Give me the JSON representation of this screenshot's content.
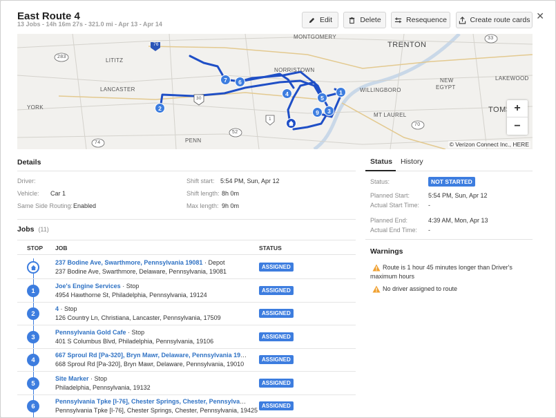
{
  "header": {
    "title": "East Route 4",
    "subtitle": "13 Jobs - 14h 16m 27s - 321.0 mi - Apr 13 - Apr 14",
    "buttons": {
      "edit": "Edit",
      "delete": "Delete",
      "resequence": "Resequence",
      "create_cards": "Create route cards"
    }
  },
  "map": {
    "labels": {
      "montgomery": "MONTGOMERY",
      "trenton": "TRENTON",
      "lititz": "LITITZ",
      "norristown": "NORRISTOWN",
      "lancaster": "LANCASTER",
      "willingboro": "WILLINGBORO",
      "lakewood": "LAKEWOOD",
      "new": "NEW",
      "egypt": "EGYPT",
      "york": "YORK",
      "toms": "TOMS",
      "mtlaurel": "MT LAUREL",
      "penn": "PENN"
    },
    "shields": {
      "s283": "283",
      "s76": "76",
      "s30": "30",
      "s1": "1",
      "s52": "52",
      "s74": "74",
      "s70": "70",
      "s33": "33"
    },
    "stops": [
      "7",
      "6",
      "5",
      "4",
      "1",
      "2",
      "9",
      "3"
    ],
    "zoom_in": "+",
    "zoom_out": "−",
    "attribution": "© Verizon Connect Inc., HERE"
  },
  "details": {
    "heading": "Details",
    "driver_label": "Driver:",
    "driver_value": "",
    "vehicle_label": "Vehicle:",
    "vehicle_value": "Car 1",
    "ssr_label": "Same Side Routing:",
    "ssr_value": "Enabled",
    "shift_start_label": "Shift start:",
    "shift_start_value": "5:54 PM, Sun, Apr 12",
    "shift_length_label": "Shift length:",
    "shift_length_value": "8h 0m",
    "max_length_label": "Max length:",
    "max_length_value": "9h 0m"
  },
  "status_panel": {
    "tabs": [
      "Status",
      "History"
    ],
    "status_label": "Status:",
    "status_value": "NOT STARTED",
    "planned_start_label": "Planned Start:",
    "planned_start_value": "5:54 PM, Sun, Apr 12",
    "actual_start_label": "Actual Start Time:",
    "actual_start_value": "-",
    "planned_end_label": "Planned End:",
    "planned_end_value": "4:39 AM, Mon, Apr 13",
    "actual_end_label": "Actual End Time:",
    "actual_end_value": "-",
    "warnings_heading": "Warnings",
    "warnings": [
      "Route is 1 hour 45 minutes longer than Driver's maximum hours",
      "No driver assigned to route"
    ],
    "warning_color": "#f0a030"
  },
  "jobs": {
    "heading": "Jobs",
    "count": "(11)",
    "columns": [
      "STOP",
      "JOB",
      "STATUS"
    ],
    "rows": [
      {
        "stop": "",
        "name": "237 Bodine Ave, Swarthmore, Pennsylvania 19081",
        "type": "· Depot",
        "address": "237 Bodine Ave, Swarthmore, Delaware, Pennsylvania, 19081",
        "status": "ASSIGNED"
      },
      {
        "stop": "1",
        "name": "Joe's Engine Services",
        "type": "· Stop",
        "address": "4954 Hawthorne St, Philadelphia, Pennsylvania, 19124",
        "status": "ASSIGNED"
      },
      {
        "stop": "2",
        "name": "4",
        "type": "· Stop",
        "address": "126 Country Ln, Christiana, Lancaster, Pennsylvania, 17509",
        "status": "ASSIGNED"
      },
      {
        "stop": "3",
        "name": "Pennsylvania Gold Cafe",
        "type": "· Stop",
        "address": "401 S Columbus Blvd, Philadelphia, Pennsylvania, 19106",
        "status": "ASSIGNED"
      },
      {
        "stop": "4",
        "name": "667 Sproul Rd [Pa-320], Bryn Mawr, Delaware, Pennsylvania 19010",
        "type": "· …",
        "address": "668 Sproul Rd [Pa-320], Bryn Mawr, Delaware, Pennsylvania, 19010",
        "status": "ASSIGNED"
      },
      {
        "stop": "5",
        "name": "Site Marker",
        "type": "· Stop",
        "address": "Philadelphia, Pennsylvania, 19132",
        "status": "ASSIGNED"
      },
      {
        "stop": "6",
        "name": "Pennsylvania Tpke [I-76], Chester Springs, Chester, Pennsylvania 1…",
        "type": "",
        "address": "Pennsylvania Tpke [I-76], Chester Springs, Chester, Pennsylvania, 19425",
        "status": "ASSIGNED"
      }
    ]
  },
  "colors": {
    "accent": "#3d7ddf",
    "route": "#1f4fc6",
    "link": "#2f72c4"
  }
}
